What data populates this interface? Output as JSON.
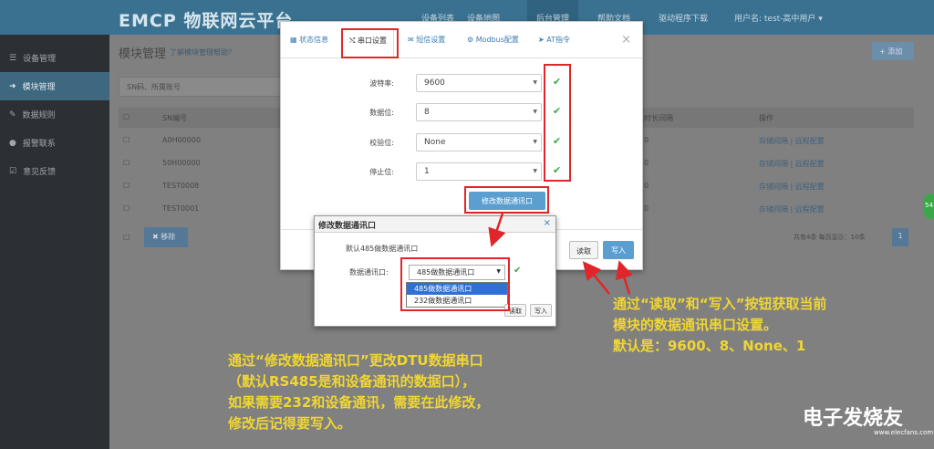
{
  "header": {
    "logo": "EMCP 物联网云平台",
    "nav": [
      "设备列表",
      "设备地图",
      "后台管理",
      "帮助文档",
      "驱动程序下载",
      "用户名: test-高中用户 ▾"
    ]
  },
  "sidebar": {
    "items": [
      "设备管理",
      "模块管理",
      "数据规则",
      "报警联系",
      "意见反馈"
    ]
  },
  "main": {
    "page_title": "模块管理",
    "page_link": "了解模块管理帮助？",
    "search_placeholder": "SN码、所属账号",
    "add_button": "+ 添加",
    "table_headers": [
      "SN编号",
      "",
      "采集时长间隔",
      "操作"
    ],
    "rows": [
      {
        "sn": "A0H00000",
        "interval": "0",
        "ops": "存储间隔 | 远程配置"
      },
      {
        "sn": "50H00000",
        "interval": "0",
        "ops": "存储间隔 | 远程配置"
      },
      {
        "sn": "TEST0008",
        "interval": "0",
        "ops": "存储间隔 | 远程配置"
      },
      {
        "sn": "TEST0001",
        "interval": "0",
        "ops": "存储间隔 | 远程配置"
      }
    ],
    "delete_button": "移除",
    "pagination_text": "共有4条   每页显示：10条",
    "page_number": "1"
  },
  "dialog": {
    "tabs": [
      "状态信息",
      "串口设置",
      "短信设置",
      "Modbus配置",
      "AT指令"
    ],
    "fields": [
      {
        "label": "波特率:",
        "value": "9600"
      },
      {
        "label": "数据位:",
        "value": "8"
      },
      {
        "label": "校验位:",
        "value": "None"
      },
      {
        "label": "停止位:",
        "value": "1"
      }
    ],
    "modify_button": "修改数据通讯口",
    "read_button": "读取",
    "write_button": "写入"
  },
  "popup": {
    "title": "修改数据通讯口",
    "note": "默认485做数据通讯口",
    "label": "数据通讯口:",
    "selected": "485做数据通讯口",
    "options": [
      "485做数据通讯口",
      "232做数据通讯口"
    ],
    "read_button": "读取",
    "write_button": "写入"
  },
  "annotations": {
    "note_right": [
      "通过“读取”和“写入”按钮获取当前",
      "模块的数据通讯串口设置。",
      "默认是：9600、8、None、1"
    ],
    "note_left": [
      "通过“修改数据通讯口”更改DTU数据串口",
      "（默认RS485是和设备通讯的数据口），",
      "如果需要232和设备通讯，需要在此修改，",
      "修改后记得要写入。"
    ]
  },
  "watermark": {
    "brand": "电子发烧友",
    "url": "www.elecfans.com"
  },
  "colors": {
    "header": "#3a7191",
    "sidebar": "#2c2f33",
    "accent": "#5a9fd0",
    "ok": "#3aa84a",
    "highlight_red": "#e0262a",
    "note_yellow": "#f0d632"
  }
}
